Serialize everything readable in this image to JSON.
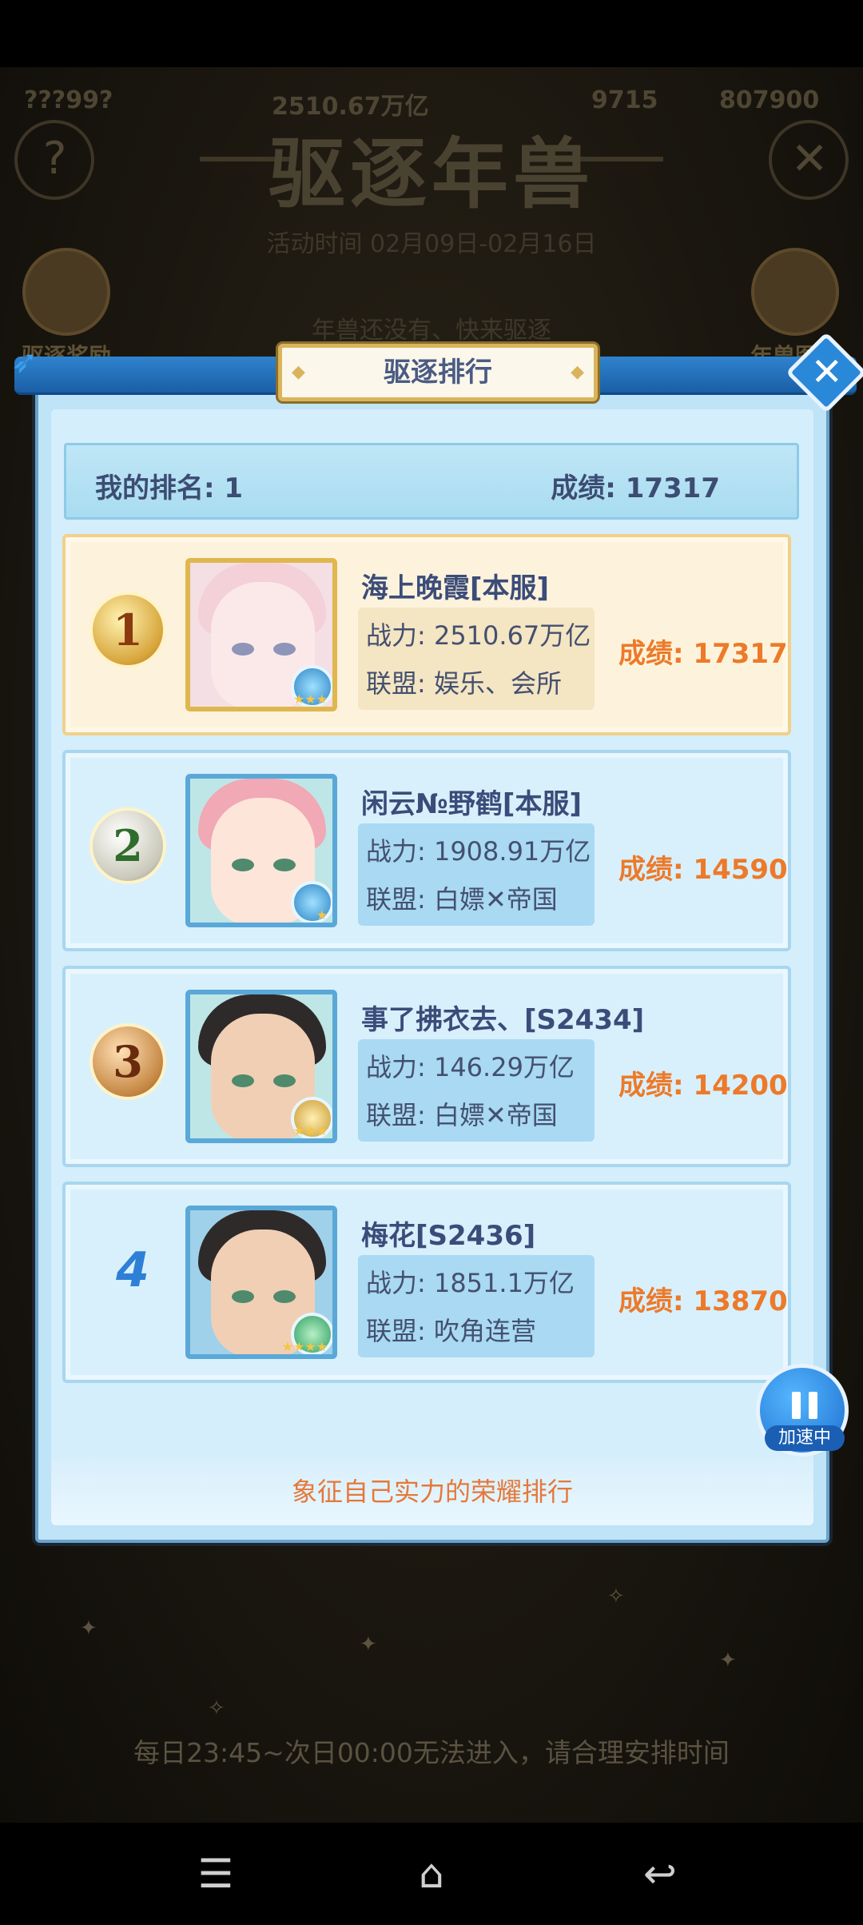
{
  "background": {
    "top_stats": [
      "???99?",
      "2510.67万亿",
      "9715",
      "807900"
    ],
    "title": "驱逐年兽",
    "subtitle": "活动时间 02月09日-02月16日",
    "info": "年兽还没有、快来驱逐",
    "left_button_label": "驱逐奖励",
    "right_button_label": "年兽图鉴",
    "footer_notice": "每日23:45~次日00:00无法进入，请合理安排时间",
    "help_icon": "?",
    "close_icon": "✕"
  },
  "panel": {
    "title": "驱逐排行",
    "my_rank_label": "我的排名: 1",
    "my_score_label": "成绩: 17317",
    "footer_text": "象征自己实力的荣耀排行",
    "close_icon": "✕"
  },
  "rankings": [
    {
      "rank": "1",
      "name": "海上晚霞[本服]",
      "power": "战力: 2510.67万亿",
      "alliance": "联盟: 娱乐、会所",
      "score": "成绩: 17317"
    },
    {
      "rank": "2",
      "name": "闲云№野鹤[本服]",
      "power": "战力: 1908.91万亿",
      "alliance": "联盟: 白嫖✕帝国",
      "score": "成绩: 14590"
    },
    {
      "rank": "3",
      "name": "事了拂衣去、[S2434]",
      "power": "战力: 146.29万亿",
      "alliance": "联盟: 白嫖✕帝国",
      "score": "成绩: 14200"
    },
    {
      "rank": "4",
      "name": "梅花[S2436]",
      "power": "战力: 1851.1万亿",
      "alliance": "联盟: 吹角连营",
      "score": "成绩: 13870"
    }
  ],
  "speed_button": {
    "label": "加速中"
  },
  "navbar": {
    "menu_icon": "☰",
    "home_icon": "⌂",
    "back_icon": "↩"
  }
}
